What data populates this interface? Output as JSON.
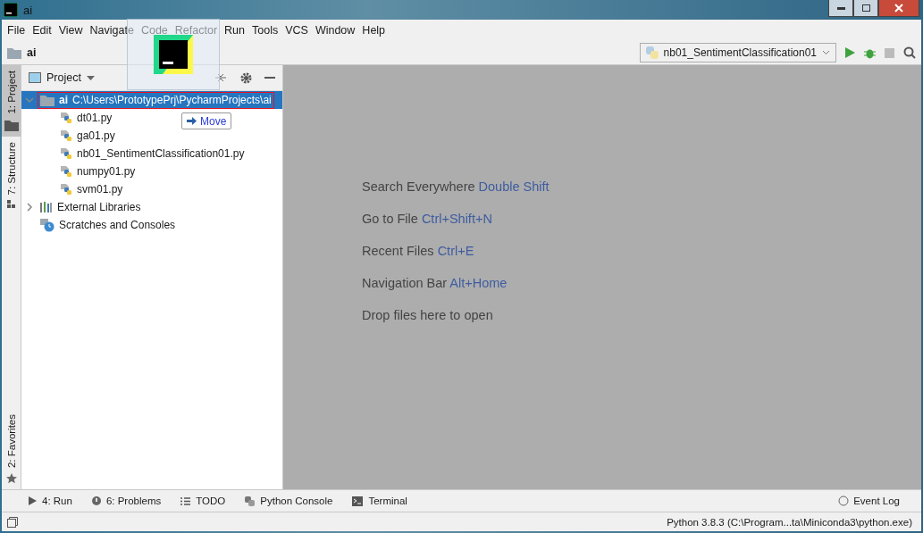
{
  "window": {
    "title": "ai"
  },
  "menu": [
    "File",
    "Edit",
    "View",
    "Navigate",
    "Code",
    "Refactor",
    "Run",
    "Tools",
    "VCS",
    "Window",
    "Help"
  ],
  "breadcrumb": "ai",
  "run_config": "nb01_SentimentClassification01",
  "side_tabs_top": [
    {
      "label": "1: Project",
      "selected": true
    },
    {
      "label": "7: Structure",
      "selected": false
    }
  ],
  "side_tabs_bottom": [
    {
      "label": "2: Favorites",
      "selected": false
    }
  ],
  "project_panel": {
    "title": "Project",
    "tree": [
      {
        "name": "ai",
        "path": "C:\\Users\\PrototypePrj\\PycharmProjects\\ai",
        "kind": "folder",
        "expanded": true,
        "selected": true,
        "children": [
          {
            "name": "dt01.py",
            "kind": "python"
          },
          {
            "name": "ga01.py",
            "kind": "python"
          },
          {
            "name": "nb01_SentimentClassification01.py",
            "kind": "python"
          },
          {
            "name": "numpy01.py",
            "kind": "python"
          },
          {
            "name": "svm01.py",
            "kind": "python"
          }
        ]
      },
      {
        "name": "External Libraries",
        "kind": "libraries",
        "expanded": false
      },
      {
        "name": "Scratches and Consoles",
        "kind": "scratches"
      }
    ]
  },
  "drag_tooltip": "Move",
  "editor_hints": [
    {
      "text": "Search Everywhere",
      "shortcut": "Double Shift"
    },
    {
      "text": "Go to File",
      "shortcut": "Ctrl+Shift+N"
    },
    {
      "text": "Recent Files",
      "shortcut": "Ctrl+E"
    },
    {
      "text": "Navigation Bar",
      "shortcut": "Alt+Home"
    },
    {
      "text": "Drop files here to open"
    }
  ],
  "bottom_tabs": [
    {
      "label": "4: Run",
      "kind": "run"
    },
    {
      "label": "6: Problems",
      "kind": "problems"
    },
    {
      "label": "TODO",
      "kind": "todo"
    },
    {
      "label": "Python Console",
      "kind": "console"
    },
    {
      "label": "Terminal",
      "kind": "terminal"
    }
  ],
  "event_log": "Event Log",
  "status_bar": "Python 3.8.3 (C:\\Program...ta\\Miniconda3\\python.exe)"
}
